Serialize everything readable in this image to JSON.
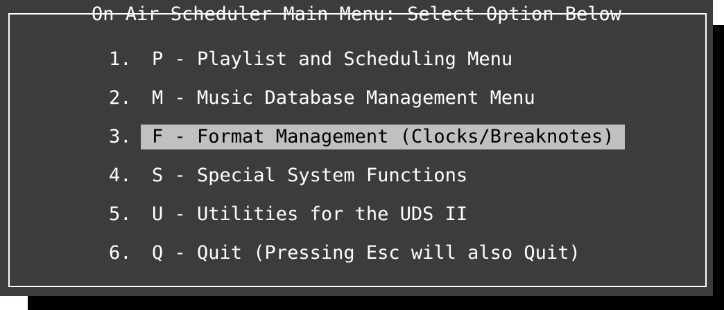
{
  "window": {
    "title": "On Air Scheduler Main Menu: Select Option Below"
  },
  "colors": {
    "background": "#3c3c3c",
    "text": "#ffffff",
    "highlight_bg": "#c0c0c0",
    "highlight_text": "#000000",
    "shadow": "#000000"
  },
  "menu": {
    "selected_index": 2,
    "items": [
      {
        "number": "1.",
        "label": "P - Playlist and Scheduling Menu"
      },
      {
        "number": "2.",
        "label": "M - Music Database Management Menu"
      },
      {
        "number": "3.",
        "label": "F - Format Management (Clocks/Breaknotes)"
      },
      {
        "number": "4.",
        "label": "S - Special System Functions"
      },
      {
        "number": "5.",
        "label": "U - Utilities for the UDS II"
      },
      {
        "number": "6.",
        "label": "Q - Quit (Pressing Esc will also Quit)"
      }
    ]
  }
}
